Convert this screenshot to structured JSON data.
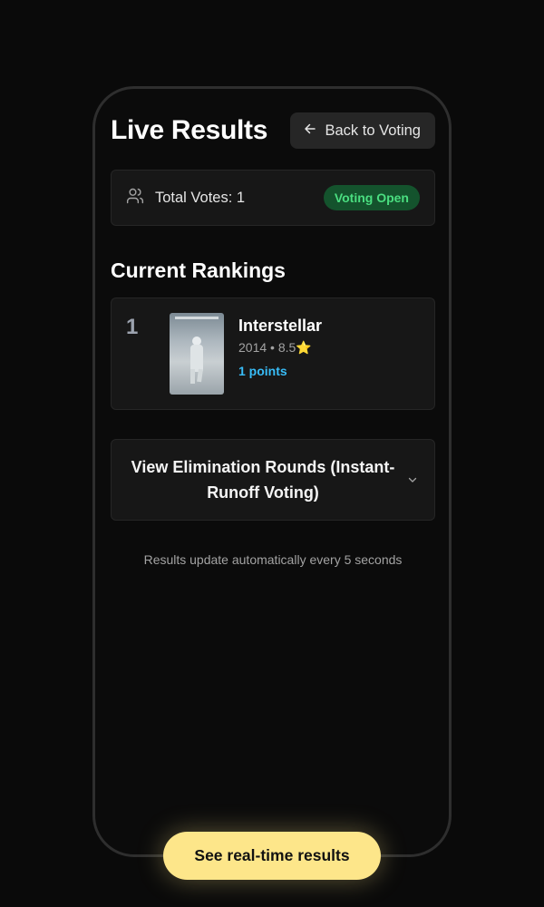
{
  "header": {
    "title": "Live Results",
    "back_button_label": "Back to Voting"
  },
  "stats": {
    "total_votes_label": "Total Votes: 1",
    "status_badge": "Voting Open"
  },
  "rankings": {
    "section_title": "Current Rankings",
    "items": [
      {
        "rank": "1",
        "title": "Interstellar",
        "meta": "2014 • 8.5⭐",
        "points": "1 points"
      }
    ]
  },
  "elimination": {
    "toggle_label": "View Elimination Rounds (Instant-Runoff Voting)"
  },
  "footer": {
    "note": "Results update automatically every 5 seconds"
  },
  "cta": {
    "label": "See real-time results"
  },
  "colors": {
    "background": "#0a0a0a",
    "card": "#171717",
    "badge_bg": "#14532d",
    "badge_text": "#4ade80",
    "points_text": "#38bdf8",
    "cta_bg": "#fde68a"
  },
  "icons": {
    "back": "arrow-left-icon",
    "votes": "users-icon",
    "accordion": "chevron-down-icon"
  }
}
